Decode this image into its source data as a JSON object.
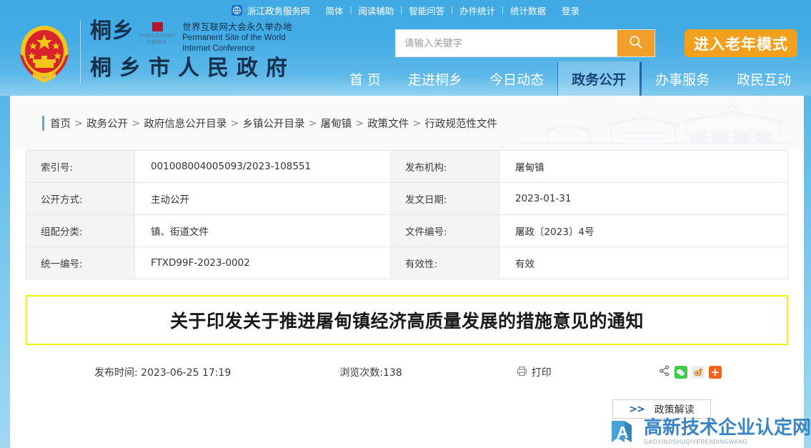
{
  "topbar": {
    "globe_icon": "globe-icon",
    "site_link": "浙江政务服务网",
    "items": [
      "简体",
      "阅读辅助",
      "智能问答",
      "办件统计",
      "统计数据"
    ],
    "login": "登录",
    "separator": "|"
  },
  "brand": {
    "emblem_icon": "national-emblem-icon",
    "calligraphy": "桐乡",
    "seal_icon": "red-seal-icon",
    "pinyin_line1": "TONGXIANG",
    "pinyin_line2": "CHINA",
    "conference_cn": "世界互联网大会永久举办地",
    "conference_en_line1": "Permanent Site of the World",
    "conference_en_line2": "Internet Conference",
    "gov_name": "桐乡市人民政府"
  },
  "search": {
    "placeholder": "请输入关键字",
    "value": "",
    "icon": "search-icon",
    "elder_mode": "进入老年模式"
  },
  "nav": {
    "items": [
      {
        "label": "首 页",
        "active": false
      },
      {
        "label": "走进桐乡",
        "active": false
      },
      {
        "label": "今日动态",
        "active": false
      },
      {
        "label": "政务公开",
        "active": true
      },
      {
        "label": "办事服务",
        "active": false
      },
      {
        "label": "政民互动",
        "active": false
      }
    ]
  },
  "breadcrumb": {
    "items": [
      "首页",
      "政务公开",
      "政府信息公开目录",
      "乡镇公开目录",
      "屠甸镇",
      "政策文件",
      "行政规范性文件"
    ],
    "separator": ">"
  },
  "info_table": {
    "rows": [
      {
        "label_left": "索引号:",
        "value_left": "001008004005093/2023-108551",
        "label_right": "发布机构:",
        "value_right": "屠甸镇"
      },
      {
        "label_left": "公开方式:",
        "value_left": "主动公开",
        "label_right": "发文日期:",
        "value_right": "2023-01-31"
      },
      {
        "label_left": "组配分类:",
        "value_left": "镇、街道文件",
        "label_right": "文件编号:",
        "value_right": "屠政〔2023〕4号"
      },
      {
        "label_left": "统一编号:",
        "value_left": "FTXD99F-2023-0002",
        "label_right": "有效性:",
        "value_right": "有效"
      }
    ]
  },
  "article": {
    "title": "关于印发关于推进屠甸镇经济高质量发展的措施意见的通知",
    "publish_time": "发布时间: 2023-06-25  17:19",
    "views": "浏览次数:138",
    "print_label": "打印",
    "print_icon": "printer-icon",
    "share_icons": [
      "share-node-icon",
      "wechat-icon",
      "weibo-icon",
      "plus-icon"
    ],
    "interpretation_arrow": ">>",
    "interpretation_label": "政策解读"
  },
  "watermark": {
    "logo_letter": "A",
    "text_cn": "高新技术企业认定网",
    "text_en": "GAOXINJISHUQIYERENDINGWANG"
  },
  "colors": {
    "header_blue": "#44ace5",
    "accent_orange": "#f3a01d",
    "title_border_yellow": "#f2f20a",
    "active_nav_text": "#103f75",
    "watermark_blue": "#2d7fc4"
  }
}
